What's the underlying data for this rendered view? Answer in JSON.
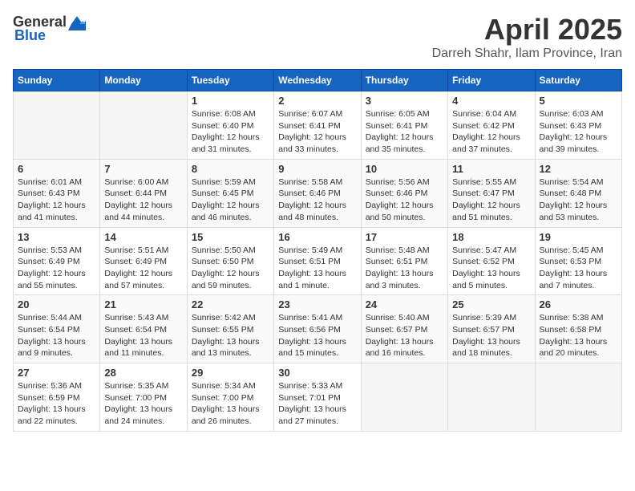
{
  "header": {
    "logo_general": "General",
    "logo_blue": "Blue",
    "title": "April 2025",
    "subtitle": "Darreh Shahr, Ilam Province, Iran"
  },
  "weekdays": [
    "Sunday",
    "Monday",
    "Tuesday",
    "Wednesday",
    "Thursday",
    "Friday",
    "Saturday"
  ],
  "weeks": [
    [
      {
        "day": "",
        "info": ""
      },
      {
        "day": "",
        "info": ""
      },
      {
        "day": "1",
        "info": "Sunrise: 6:08 AM\nSunset: 6:40 PM\nDaylight: 12 hours\nand 31 minutes."
      },
      {
        "day": "2",
        "info": "Sunrise: 6:07 AM\nSunset: 6:41 PM\nDaylight: 12 hours\nand 33 minutes."
      },
      {
        "day": "3",
        "info": "Sunrise: 6:05 AM\nSunset: 6:41 PM\nDaylight: 12 hours\nand 35 minutes."
      },
      {
        "day": "4",
        "info": "Sunrise: 6:04 AM\nSunset: 6:42 PM\nDaylight: 12 hours\nand 37 minutes."
      },
      {
        "day": "5",
        "info": "Sunrise: 6:03 AM\nSunset: 6:43 PM\nDaylight: 12 hours\nand 39 minutes."
      }
    ],
    [
      {
        "day": "6",
        "info": "Sunrise: 6:01 AM\nSunset: 6:43 PM\nDaylight: 12 hours\nand 41 minutes."
      },
      {
        "day": "7",
        "info": "Sunrise: 6:00 AM\nSunset: 6:44 PM\nDaylight: 12 hours\nand 44 minutes."
      },
      {
        "day": "8",
        "info": "Sunrise: 5:59 AM\nSunset: 6:45 PM\nDaylight: 12 hours\nand 46 minutes."
      },
      {
        "day": "9",
        "info": "Sunrise: 5:58 AM\nSunset: 6:46 PM\nDaylight: 12 hours\nand 48 minutes."
      },
      {
        "day": "10",
        "info": "Sunrise: 5:56 AM\nSunset: 6:46 PM\nDaylight: 12 hours\nand 50 minutes."
      },
      {
        "day": "11",
        "info": "Sunrise: 5:55 AM\nSunset: 6:47 PM\nDaylight: 12 hours\nand 51 minutes."
      },
      {
        "day": "12",
        "info": "Sunrise: 5:54 AM\nSunset: 6:48 PM\nDaylight: 12 hours\nand 53 minutes."
      }
    ],
    [
      {
        "day": "13",
        "info": "Sunrise: 5:53 AM\nSunset: 6:49 PM\nDaylight: 12 hours\nand 55 minutes."
      },
      {
        "day": "14",
        "info": "Sunrise: 5:51 AM\nSunset: 6:49 PM\nDaylight: 12 hours\nand 57 minutes."
      },
      {
        "day": "15",
        "info": "Sunrise: 5:50 AM\nSunset: 6:50 PM\nDaylight: 12 hours\nand 59 minutes."
      },
      {
        "day": "16",
        "info": "Sunrise: 5:49 AM\nSunset: 6:51 PM\nDaylight: 13 hours\nand 1 minute."
      },
      {
        "day": "17",
        "info": "Sunrise: 5:48 AM\nSunset: 6:51 PM\nDaylight: 13 hours\nand 3 minutes."
      },
      {
        "day": "18",
        "info": "Sunrise: 5:47 AM\nSunset: 6:52 PM\nDaylight: 13 hours\nand 5 minutes."
      },
      {
        "day": "19",
        "info": "Sunrise: 5:45 AM\nSunset: 6:53 PM\nDaylight: 13 hours\nand 7 minutes."
      }
    ],
    [
      {
        "day": "20",
        "info": "Sunrise: 5:44 AM\nSunset: 6:54 PM\nDaylight: 13 hours\nand 9 minutes."
      },
      {
        "day": "21",
        "info": "Sunrise: 5:43 AM\nSunset: 6:54 PM\nDaylight: 13 hours\nand 11 minutes."
      },
      {
        "day": "22",
        "info": "Sunrise: 5:42 AM\nSunset: 6:55 PM\nDaylight: 13 hours\nand 13 minutes."
      },
      {
        "day": "23",
        "info": "Sunrise: 5:41 AM\nSunset: 6:56 PM\nDaylight: 13 hours\nand 15 minutes."
      },
      {
        "day": "24",
        "info": "Sunrise: 5:40 AM\nSunset: 6:57 PM\nDaylight: 13 hours\nand 16 minutes."
      },
      {
        "day": "25",
        "info": "Sunrise: 5:39 AM\nSunset: 6:57 PM\nDaylight: 13 hours\nand 18 minutes."
      },
      {
        "day": "26",
        "info": "Sunrise: 5:38 AM\nSunset: 6:58 PM\nDaylight: 13 hours\nand 20 minutes."
      }
    ],
    [
      {
        "day": "27",
        "info": "Sunrise: 5:36 AM\nSunset: 6:59 PM\nDaylight: 13 hours\nand 22 minutes."
      },
      {
        "day": "28",
        "info": "Sunrise: 5:35 AM\nSunset: 7:00 PM\nDaylight: 13 hours\nand 24 minutes."
      },
      {
        "day": "29",
        "info": "Sunrise: 5:34 AM\nSunset: 7:00 PM\nDaylight: 13 hours\nand 26 minutes."
      },
      {
        "day": "30",
        "info": "Sunrise: 5:33 AM\nSunset: 7:01 PM\nDaylight: 13 hours\nand 27 minutes."
      },
      {
        "day": "",
        "info": ""
      },
      {
        "day": "",
        "info": ""
      },
      {
        "day": "",
        "info": ""
      }
    ]
  ]
}
